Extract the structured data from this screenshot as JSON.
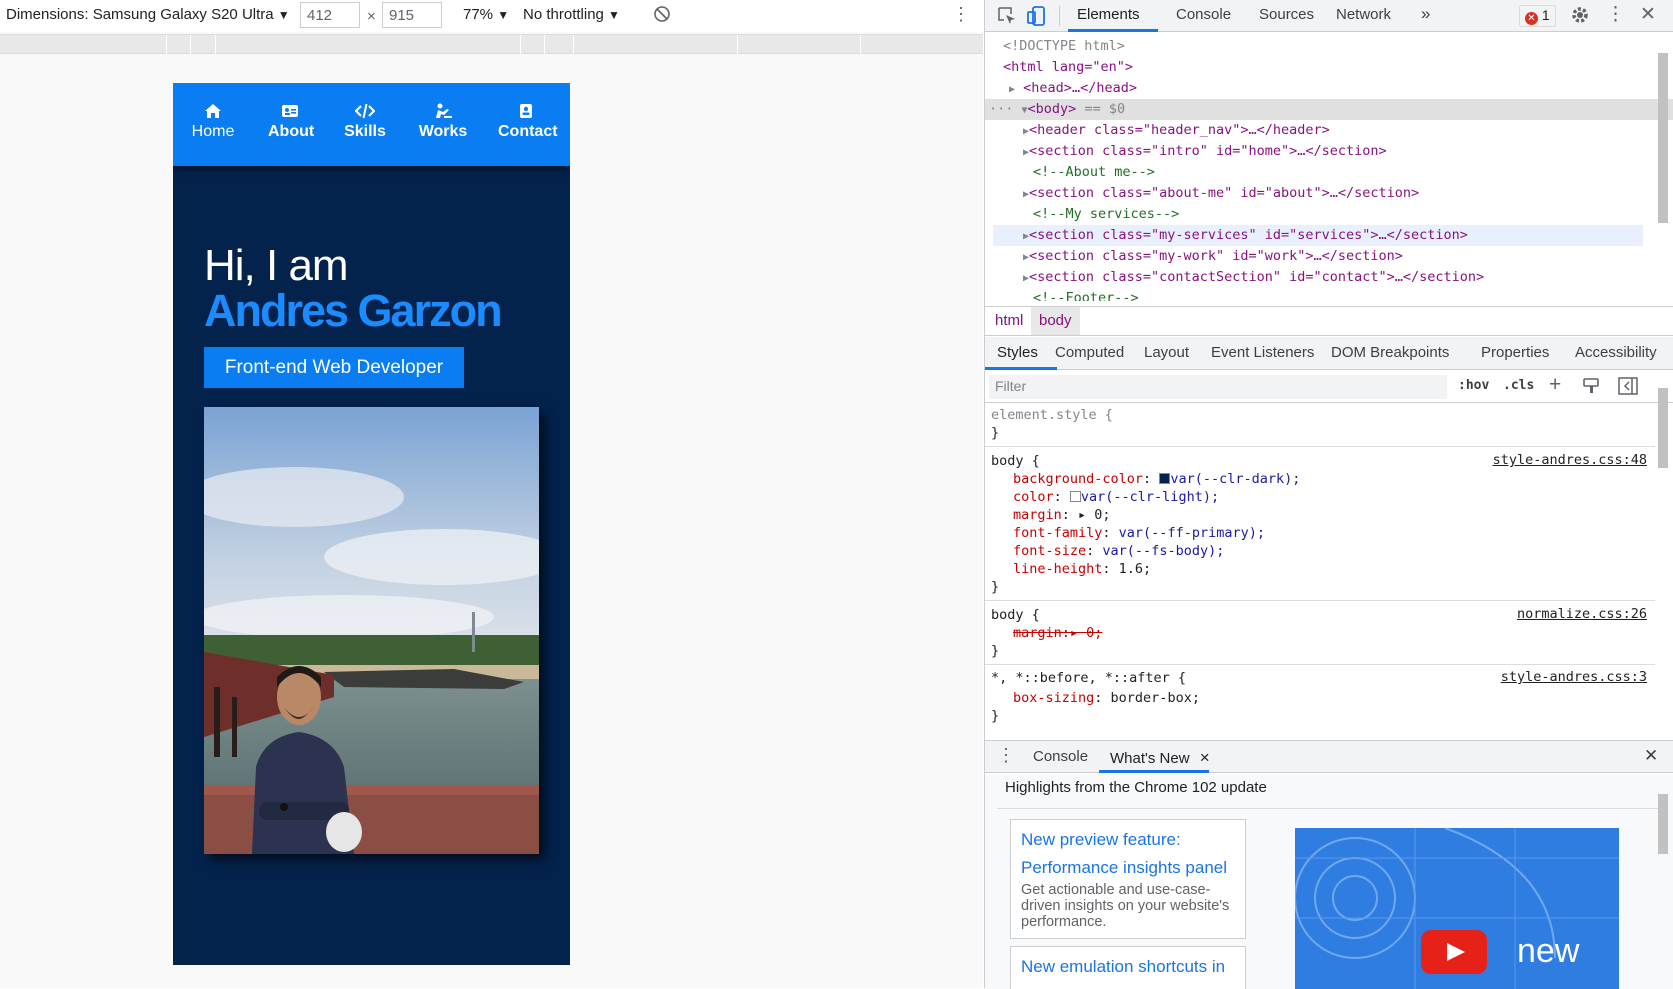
{
  "toolbar": {
    "dimensions_label": "Dimensions: Samsung Galaxy S20 Ultra",
    "width": "412",
    "height": "915",
    "times": "×",
    "zoom": "77%",
    "throttling": "No throttling",
    "dropdown_arrow": "▼",
    "more": "⋮"
  },
  "site": {
    "nav": [
      {
        "label": "Home",
        "icon": "home-icon"
      },
      {
        "label": "About",
        "icon": "id-card-icon"
      },
      {
        "label": "Skills",
        "icon": "code-icon"
      },
      {
        "label": "Works",
        "icon": "person-working-icon"
      },
      {
        "label": "Contact",
        "icon": "contact-card-icon"
      }
    ],
    "greeting": "Hi, I am",
    "name": "Andres Garzon",
    "role": "Front-end Web Developer"
  },
  "devtools": {
    "tabs": [
      "Elements",
      "Console",
      "Sources",
      "Network"
    ],
    "more_tabs": "»",
    "error_count": "1",
    "dom": {
      "doctype": "<!DOCTYPE html>",
      "html_open": "<html lang=\"en\">",
      "head": "<head>…</head>",
      "body_tag": "<body>",
      "body_marker": "== $0",
      "header": "<header class=\"header_nav\">…</header>",
      "intro": "<section class=\"intro\" id=\"home\">…</section>",
      "comment_about": "<!--About me-->",
      "about": "<section class=\"about-me\" id=\"about\">…</section>",
      "comment_services": "<!--My services-->",
      "services": "<section class=\"my-services\" id=\"services\">…</section>",
      "work": "<section class=\"my-work\" id=\"work\">…</section>",
      "contact": "<section class=\"contactSection\" id=\"contact\">…</section>",
      "comment_footer": "<!--Footer-->"
    },
    "breadcrumbs": [
      "html",
      "body"
    ],
    "subtabs": [
      "Styles",
      "Computed",
      "Layout",
      "Event Listeners",
      "DOM Breakpoints",
      "Properties",
      "Accessibility"
    ],
    "filter_placeholder": "Filter",
    "hov": ":hov",
    "cls": ".cls",
    "styles": {
      "element_style": "element.style {",
      "close": "}",
      "body_selector": "body {",
      "body_source": "style-andres.css:48",
      "decls": [
        {
          "prop": "background-color",
          "val": "var(--clr-dark);",
          "swatch": "#03224c"
        },
        {
          "prop": "color",
          "val": "var(--clr-light);",
          "swatch": "#ffffff"
        },
        {
          "prop": "margin",
          "val": "▸ 0;"
        },
        {
          "prop": "font-family",
          "val": "var(--ff-primary);"
        },
        {
          "prop": "font-size",
          "val": "var(--fs-body);"
        },
        {
          "prop": "line-height",
          "val": "1.6;"
        }
      ],
      "normalize_selector": "body {",
      "normalize_source": "normalize.css:26",
      "normalize_decl": "margin:▸ 0;",
      "universal_selector": "*, *::before, *::after {",
      "universal_source": "style-andres.css:3",
      "universal_decl_prop": "box-sizing",
      "universal_decl_val": "border-box;"
    },
    "drawer": {
      "tabs": [
        "Console",
        "What's New"
      ],
      "close_tab": "×",
      "close": "✕",
      "highlights": "Highlights from the Chrome 102 update",
      "card1_title_1": "New preview feature:",
      "card1_title_2": "Performance insights panel",
      "card1_body": "Get actionable and use-case-driven insights on your website's performance.",
      "card2_title": "New emulation shortcuts in",
      "video_label": "new"
    }
  },
  "colors": {
    "site_bg": "#03224c",
    "site_accent": "#0b7df2",
    "name_color": "#1a8cff",
    "devtools_accent": "#1a73e8"
  }
}
